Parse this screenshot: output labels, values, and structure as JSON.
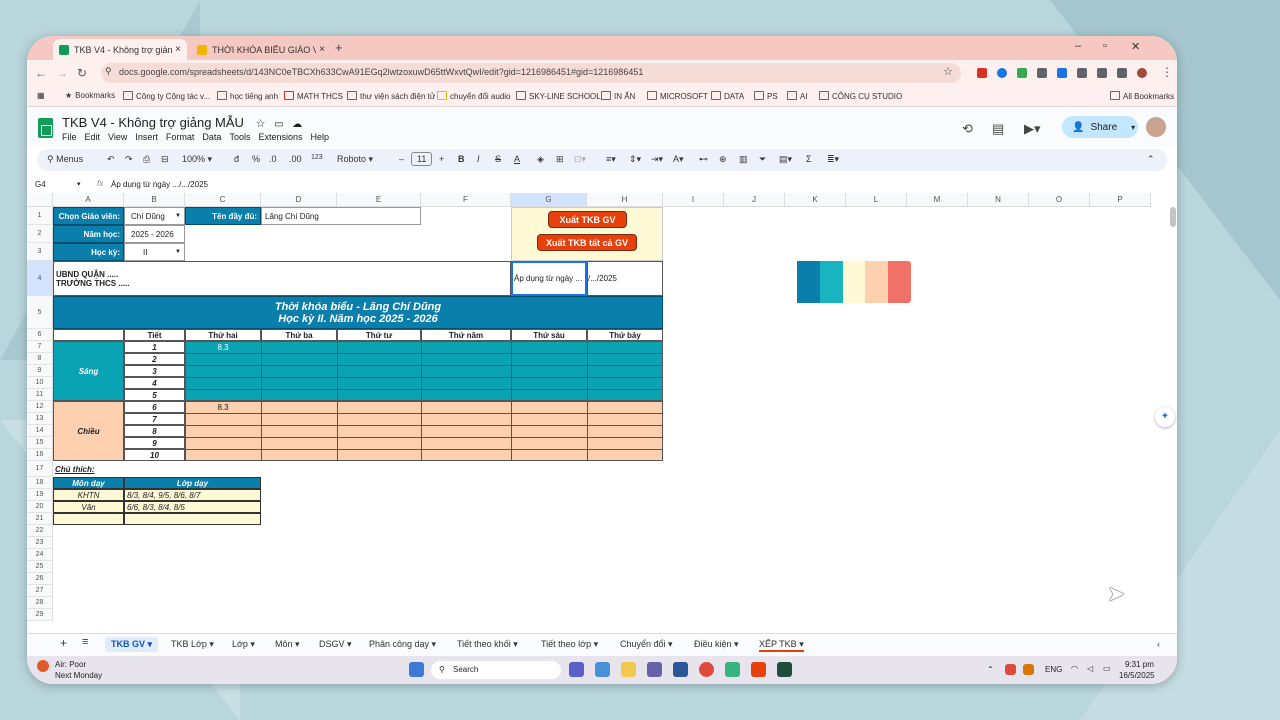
{
  "browser": {
    "tabs": [
      {
        "label": "TKB V4 - Không trợ giảng MẪU"
      },
      {
        "label": "THỜI KHÓA BIỂU GIÁO VIÊN - ..."
      }
    ],
    "url": "docs.google.com/spreadsheets/d/143NC0eTBCXh633CwA91EGq2lwtzoxuwD65ttWxvtQwI/edit?gid=1216986451#gid=1216986451",
    "bookmarks": [
      "Bookmarks",
      "Công ty Cộng tác v...",
      "học tiếng anh",
      "MATH THCS",
      "thư viện sách điện tử",
      "chuyển đổi audio",
      "SKY-LINE SCHOOL",
      "IN ẤN",
      "MICROSOFT",
      "DATA",
      "PS",
      "AI",
      "CÔNG CỤ STUDIO",
      "All Bookmarks"
    ]
  },
  "sheets": {
    "title": "TKB V4 - Không trợ giảng MẪU",
    "menu": [
      "File",
      "Edit",
      "View",
      "Insert",
      "Format",
      "Data",
      "Tools",
      "Extensions",
      "Help"
    ],
    "share_label": "Share",
    "toolbar": {
      "menus": "Menus",
      "zoom": "100%",
      "font": "Roboto",
      "font_size": "11",
      "currency": "đ",
      "percent": "%",
      "dec_minus": ".0",
      "dec_plus": ".00",
      "number_format": "123"
    },
    "name_box": "G4",
    "formula": "Áp dụng từ ngày .../.../2025"
  },
  "columns": [
    "A",
    "B",
    "C",
    "D",
    "E",
    "F",
    "G",
    "H",
    "I",
    "J",
    "K",
    "L",
    "M",
    "N",
    "O",
    "P"
  ],
  "rows": [
    "1",
    "2",
    "3",
    "4",
    "5",
    "6",
    "7",
    "8",
    "9",
    "10",
    "11",
    "12",
    "13",
    "14",
    "15",
    "16",
    "17",
    "18",
    "19",
    "20",
    "21",
    "22",
    "23",
    "24",
    "25",
    "26",
    "27",
    "28",
    "29"
  ],
  "form": {
    "chon_gv_label": "Chọn Giáo viên:",
    "chon_gv_value": "Chí Dũng",
    "ten_label": "Tên đầy đủ:",
    "ten_value": "Lăng Chí Dũng",
    "nam_hoc_label": "Năm học:",
    "nam_hoc_value": "2025 - 2026",
    "hoc_ky_label": "Học kỳ:",
    "hoc_ky_value": "II",
    "btn_xuat_gv": "Xuất TKB GV",
    "btn_xuat_tatca": "Xuất TKB tất cả GV",
    "ubnd": "UBND QUẬN .....",
    "truong": "TRƯỜNG THCS .....",
    "ap_dung_g": "Áp dụng từ ngày ...",
    "ap_dung_h": "/.../2025"
  },
  "timetable": {
    "title1": "Thời khóa biểu - Lăng Chí Dũng",
    "title2": "Học kỳ II. Năm học 2025 - 2026",
    "tiet_header": "Tiết",
    "days": [
      "Thứ hai",
      "Thứ ba",
      "Thứ tư",
      "Thứ năm",
      "Thứ sáu",
      "Thứ bảy"
    ],
    "sang": "Sáng",
    "chieu": "Chiều",
    "periods": [
      "1",
      "2",
      "3",
      "4",
      "5",
      "6",
      "7",
      "8",
      "9",
      "10"
    ],
    "mon_entry_1": "8.3",
    "mon_entry_6": "8.3"
  },
  "notes": {
    "label": "Chú thích:",
    "h_mon": "Môn dạy",
    "h_lop": "Lớp dạy",
    "rows": [
      {
        "mon": "KHTN",
        "lop": "8/3, 8/4, 9/5, 8/6, 8/7"
      },
      {
        "mon": "Văn",
        "lop": "6/6, 8/3, 8/4, 8/5"
      }
    ]
  },
  "sheet_tabs": [
    "TKB GV",
    "TKB Lớp",
    "Lớp",
    "Môn",
    "DSGV",
    "Phân công dạy",
    "Tiết theo khối",
    "Tiết theo lớp",
    "Chuyển đổi",
    "Điều kiện",
    "XẾP TKB"
  ],
  "taskbar": {
    "weather1": "Air: Poor",
    "weather2": "Next Monday",
    "search": "Search",
    "lang": "ENG",
    "time": "9:31 pm",
    "date": "16/5/2025"
  },
  "palette": [
    "#0b7fab",
    "#18b5c1",
    "#fff9d6",
    "#fdd1b0",
    "#f07167"
  ],
  "colors": {
    "teal_header": "#0b7fab",
    "teal_cell": "#0aa3b3",
    "peach": "#fdd1b0",
    "yellow": "#fff9d6"
  }
}
